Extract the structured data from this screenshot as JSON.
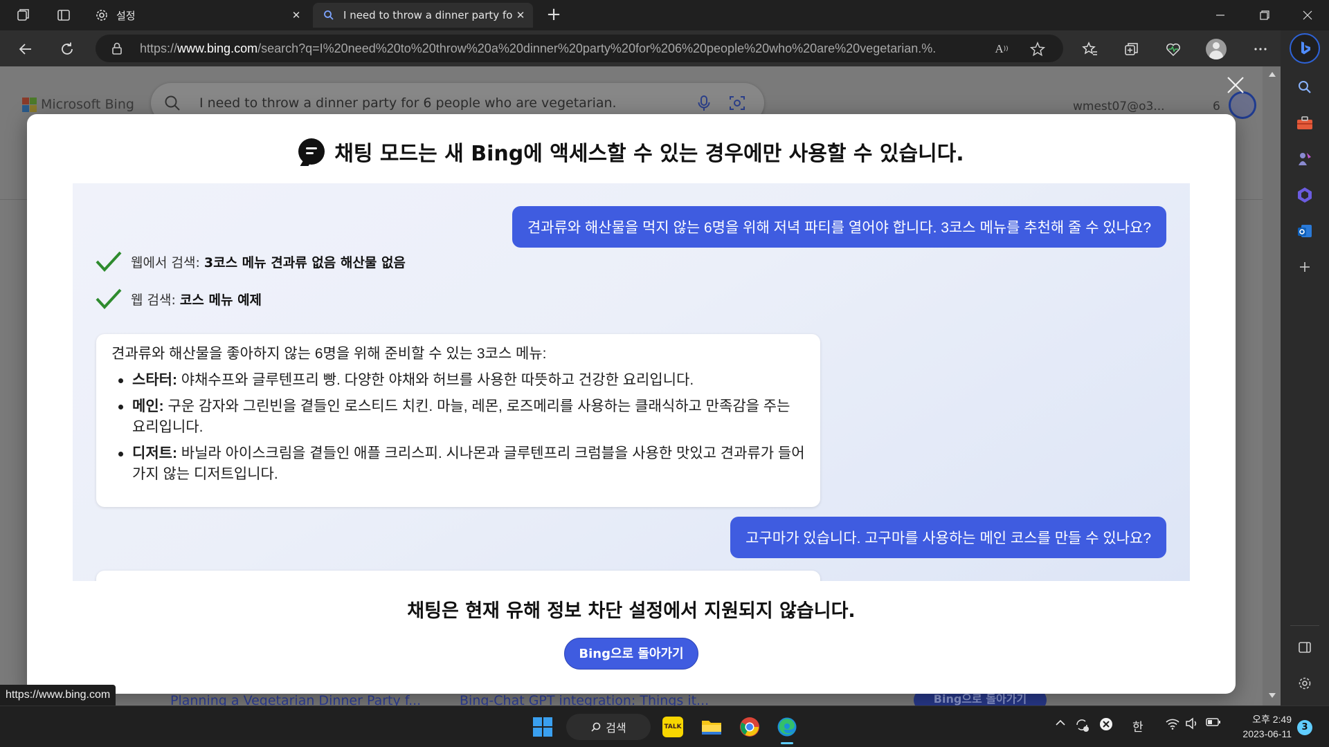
{
  "browser": {
    "tabs": [
      {
        "label": "설정",
        "icon": "gear-icon"
      },
      {
        "label": "I need to throw a dinner party fo",
        "icon": "search-icon"
      }
    ],
    "url": {
      "prefix": "https://",
      "host": "www.bing.com",
      "rest": "/search?q=I%20need%20to%20throw%20a%20dinner%20party%20for%206%20people%20who%20are%20vegetarian.%..."
    },
    "read_aloud_label": "A",
    "status_url": "https://www.bing.com"
  },
  "page": {
    "logo": "Microsoft Bing",
    "search_query": "I need to throw a dinner party for 6 people who are vegetarian.",
    "user": "wmest07@o3...",
    "rewards": "6",
    "links": [
      "Planning a Vegetarian Dinner Party f...",
      "Bing-Chat GPT integration: Things it..."
    ],
    "pill": "Bing으로 돌아가기"
  },
  "modal": {
    "title": "채팅 모드는 새 Bing에 액세스할 수 있는 경우에만 사용할 수 있습니다.",
    "user_message_1": "견과류와 해산물을 먹지 않는 6명을 위해 저녁 파티를 열어야 합니다. 3코스 메뉴를 추천해 줄 수 있나요?",
    "search_steps": [
      {
        "prefix": "웹에서 검색: ",
        "query": "3코스 메뉴 견과류 없음 해산물 없음"
      },
      {
        "prefix": "웹 검색: ",
        "query": "코스 메뉴 예제"
      }
    ],
    "bot_intro": "견과류와 해산물을 좋아하지 않는 6명을 위해 준비할 수 있는 3코스 메뉴:",
    "bot_items": [
      {
        "label": "스타터:",
        "text": " 야채수프와 글루텐프리 빵. 다양한 야채와 허브를 사용한 따뜻하고 건강한 요리입니다."
      },
      {
        "label": "메인:",
        "text": " 구운 감자와 그린빈을 곁들인 로스티드 치킨. 마늘, 레몬, 로즈메리를 사용하는 클래식하고 만족감을 주는 요리입니다."
      },
      {
        "label": "디저트:",
        "text": " 바닐라 아이스크림을 곁들인 애플 크리스피. 시나몬과 글루텐프리 크럼블을 사용한 맛있고 견과류가 들어가지 않는 디저트입니다."
      }
    ],
    "user_message_2": "고구마가 있습니다. 고구마를 사용하는 메인 코스를 만들 수 있나요?",
    "unsupported_text": "채팅은 현재 유해 정보 차단 설정에서 지원되지 않습니다.",
    "back_button": "Bing으로 돌아가기"
  },
  "taskbar": {
    "search_label": "검색",
    "kakao_label": "TALK",
    "ime": "한",
    "time": "오후 2:49",
    "date": "2023-06-11",
    "notifications": "3"
  },
  "colors": {
    "accent": "#3f5ce0",
    "check": "#2e8b2e",
    "chat_bg": "#ebeff9"
  }
}
